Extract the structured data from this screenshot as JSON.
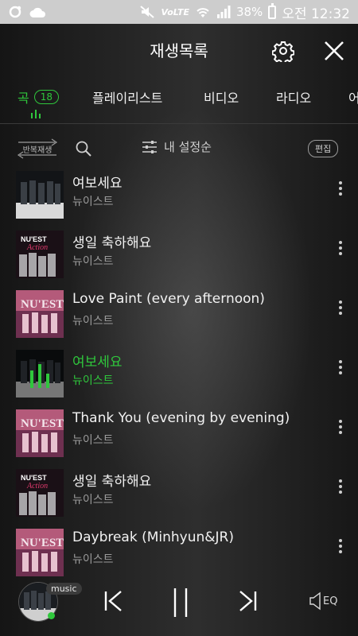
{
  "statusbar": {
    "battery": "38%",
    "network": "VoLTE",
    "time_label": "오전 12:32"
  },
  "header": {
    "title": "재생목록"
  },
  "tabs": [
    {
      "label": "곡",
      "count": "18"
    },
    {
      "label": "플레이리스트"
    },
    {
      "label": "비디오"
    },
    {
      "label": "라디오"
    },
    {
      "label": "어"
    }
  ],
  "toolbar": {
    "repeat_label": "반복재생",
    "sort_label": "내 설정순",
    "edit_label": "편집"
  },
  "tracks": [
    {
      "title": "여보세요",
      "artist": "뉴이스트"
    },
    {
      "title": "생일 축하해요",
      "artist": "뉴이스트"
    },
    {
      "title": "Love Paint (every afternoon)",
      "artist": "뉴이스트"
    },
    {
      "title": "여보세요",
      "artist": "뉴이스트"
    },
    {
      "title": "Thank You (evening by evening)",
      "artist": "뉴이스트"
    },
    {
      "title": "생일 축하해요",
      "artist": "뉴이스트"
    },
    {
      "title": "Daybreak (Minhyun&JR)",
      "artist": "뉴이스트"
    }
  ],
  "player": {
    "source_label": "music",
    "eq_label": "EQ"
  },
  "colors": {
    "accent": "#2fc73c"
  }
}
